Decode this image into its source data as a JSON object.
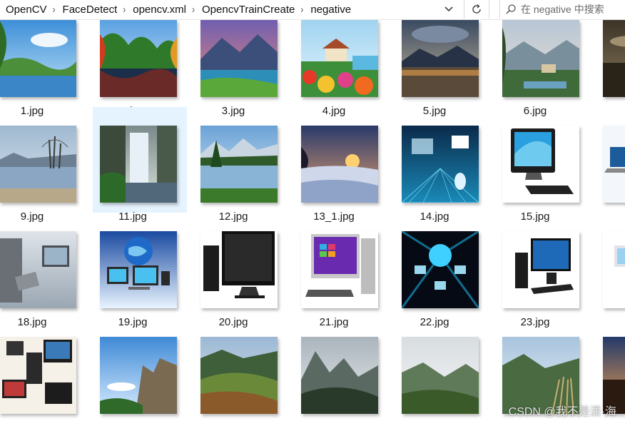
{
  "breadcrumb": [
    "OpenCV",
    "FaceDetect",
    "opencv.xml",
    "OpencvTrainCreate",
    "negative"
  ],
  "search": {
    "placeholder": "在 negative 中搜索"
  },
  "icons": {
    "separator": "chevron-right-icon",
    "dropdown": "chevron-down-icon",
    "refresh": "refresh-icon",
    "search": "search-icon"
  },
  "files": [
    {
      "name": "1.jpg",
      "theme": "lake-sky"
    },
    {
      "name": "2.jpg",
      "theme": "autumn-lake"
    },
    {
      "name": "3.jpg",
      "theme": "sunset-mountain"
    },
    {
      "name": "4.jpg",
      "theme": "flower-cottage"
    },
    {
      "name": "5.jpg",
      "theme": "dusk-lake"
    },
    {
      "name": "6.jpg",
      "theme": "painted-village"
    },
    {
      "name": "",
      "theme": "dark-landscape"
    },
    {
      "name": "9.jpg",
      "theme": "winter-lake"
    },
    {
      "name": "11.jpg",
      "theme": "waterfall",
      "selected": true
    },
    {
      "name": "12.jpg",
      "theme": "alpine-lake"
    },
    {
      "name": "13_1.jpg",
      "theme": "snow-sunset"
    },
    {
      "name": "14.jpg",
      "theme": "tech-blue"
    },
    {
      "name": "15.jpg",
      "theme": "computer-monitor"
    },
    {
      "name": "",
      "theme": "laptop-blue"
    },
    {
      "name": "18.jpg",
      "theme": "tech-office"
    },
    {
      "name": "19.jpg",
      "theme": "devices-globe"
    },
    {
      "name": "20.jpg",
      "theme": "black-monitor"
    },
    {
      "name": "21.jpg",
      "theme": "desktop-purple"
    },
    {
      "name": "22.jpg",
      "theme": "network-dark"
    },
    {
      "name": "23.jpg",
      "theme": "desktop-dark"
    },
    {
      "name": "",
      "theme": "white-pc"
    },
    {
      "name": "",
      "theme": "computers-collage"
    },
    {
      "name": "",
      "theme": "cliff-sky"
    },
    {
      "name": "",
      "theme": "green-hills"
    },
    {
      "name": "",
      "theme": "misty-mountains"
    },
    {
      "name": "",
      "theme": "cloudy-valley"
    },
    {
      "name": "",
      "theme": "valley-reeds"
    },
    {
      "name": "",
      "theme": "sunset-edge"
    }
  ],
  "watermark": "CSDN @我不是潇·海"
}
